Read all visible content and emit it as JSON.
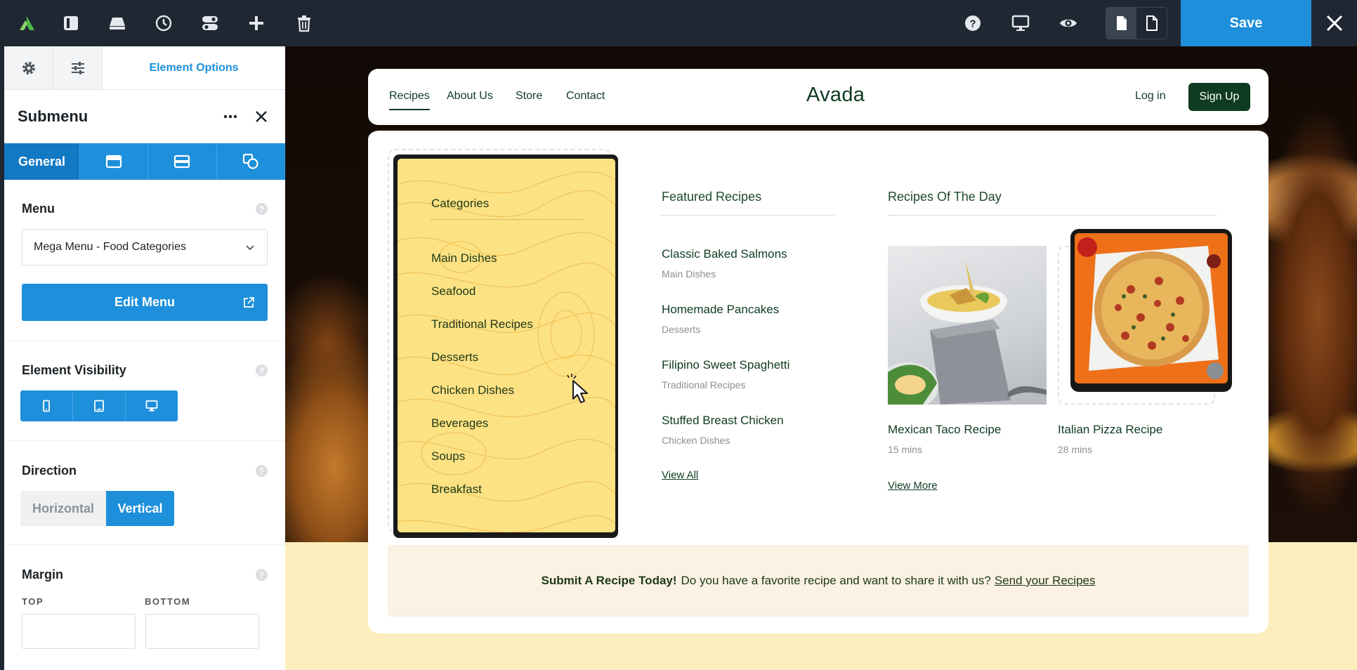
{
  "topbar": {
    "save_label": "Save",
    "icons": [
      "avada-logo-icon",
      "layout-icon",
      "library-icon",
      "history-icon",
      "toggle-icon",
      "plus-icon",
      "trash-icon",
      "help-icon",
      "desktop-icon",
      "eye-icon",
      "page-icon",
      "page-outline-icon",
      "close-icon"
    ]
  },
  "sidebar": {
    "tab_main": "Element Options",
    "element_title": "Submenu",
    "subtab_general": "General",
    "menu": {
      "label": "Menu",
      "selected": "Mega Menu - Food Categories",
      "edit_label": "Edit Menu"
    },
    "visibility": {
      "label": "Element Visibility"
    },
    "direction": {
      "label": "Direction",
      "horizontal": "Horizontal",
      "vertical": "Vertical",
      "selected": "Vertical"
    },
    "margin": {
      "label": "Margin",
      "top_label": "TOP",
      "bottom_label": "BOTTOM",
      "top_value": "",
      "bottom_value": ""
    },
    "help_glyph": "?"
  },
  "site": {
    "nav": {
      "links": [
        "Recipes",
        "About Us",
        "Store",
        "Contact"
      ],
      "active": "Recipes",
      "logo": "Avada",
      "login": "Log in",
      "signup": "Sign Up"
    },
    "categories": {
      "title": "Categories",
      "items": [
        "Main Dishes",
        "Seafood",
        "Traditional Recipes",
        "Desserts",
        "Chicken Dishes",
        "Beverages",
        "Soups",
        "Breakfast"
      ]
    },
    "featured": {
      "title": "Featured Recipes",
      "items": [
        {
          "title": "Classic Baked Salmons",
          "category": "Main Dishes"
        },
        {
          "title": "Homemade Pancakes",
          "category": "Desserts"
        },
        {
          "title": "Filipino Sweet Spaghetti",
          "category": "Traditional Recipes"
        },
        {
          "title": "Stuffed Breast Chicken",
          "category": "Chicken Dishes"
        }
      ],
      "view_all": "View All"
    },
    "of_the_day": {
      "title": "Recipes Of The Day",
      "items": [
        {
          "title": "Mexican Taco Recipe",
          "time": "15 mins"
        },
        {
          "title": "Italian Pizza Recipe",
          "time": "28 mins"
        }
      ],
      "view_more": "View More"
    },
    "submit": {
      "strong": "Submit A Recipe Today!",
      "text": "Do you have a favorite recipe and want to share it with us?",
      "link": "Send your Recipes"
    }
  },
  "colors": {
    "accent": "#1d8fdb",
    "topbar": "#1f2733",
    "brand_green": "#0f3b21",
    "category_yellow": "#fde283"
  }
}
